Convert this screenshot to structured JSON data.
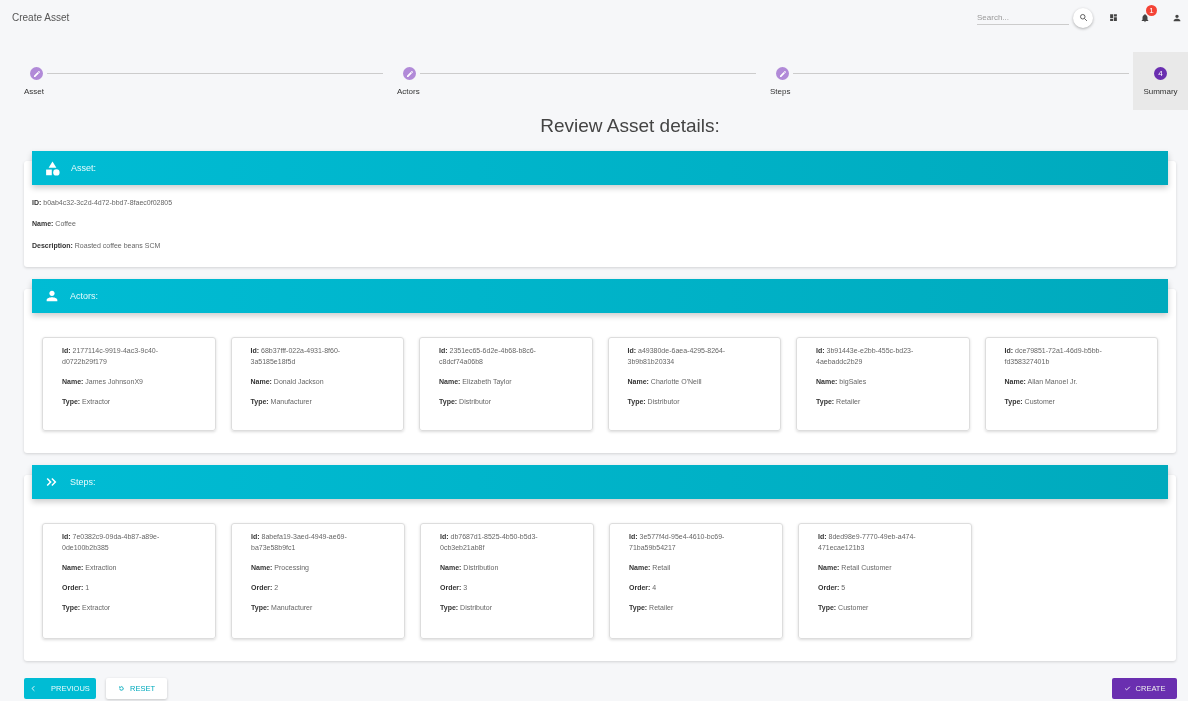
{
  "window": {
    "title": "Create Asset"
  },
  "toolbar": {
    "search": {
      "placeholder": "Search..."
    },
    "notifications": {
      "badge": "1"
    }
  },
  "stepper": [
    {
      "label": "Asset",
      "edited": true,
      "selected": false
    },
    {
      "label": "Actors",
      "edited": true,
      "selected": false
    },
    {
      "label": "Steps",
      "edited": true,
      "selected": false
    },
    {
      "label": "Summary",
      "edited": false,
      "number": "4",
      "selected": true
    }
  ],
  "heading": "Review Asset details:",
  "sections": [
    {
      "kind": "asset",
      "title": "Asset:",
      "fields": [
        "**ID:** b0ab4c32-3c2d-4d72-bbd7-8faec0f02805",
        "**Name:** Coffee",
        "**Description:** Roasted coffee beans SCM"
      ]
    },
    {
      "kind": "actors",
      "title": "Actors:",
      "cards": [
        {
          "fields": [
            "**Id:** 2177114c-9919-4ac3-9c40-d0722b29f179",
            "**Name:** James JohnsonX9",
            "**Type:** Extractor"
          ]
        },
        {
          "fields": [
            "**Id:** 68b37fff-022a-4931-8f60-3a5185e18f5d",
            "**Name:** Donald Jackson",
            "**Type:** Manufacturer"
          ]
        },
        {
          "fields": [
            "**Id:** 2351ec65-6d2e-4b68-b8c6-c8dcf74a06b8",
            "**Name:** Elizabeth Taylor",
            "**Type:** Distributor"
          ]
        },
        {
          "fields": [
            "**Id:** a49380de-6aea-4295-8264-3b9b81b20334",
            "**Name:** Charlotte O'Neill",
            "**Type:** Distributor"
          ]
        },
        {
          "fields": [
            "**Id:** 3b91443e-e2bb-455c-bd23-4aebaddc2b29",
            "**Name:** bigSales",
            "**Type:** Retailer"
          ]
        },
        {
          "fields": [
            "**Id:** dce79851-72a1-46d9-b5bb-fd358327401b",
            "**Name:** Allan Manoel Jr.",
            "**Type:** Customer"
          ]
        }
      ]
    },
    {
      "kind": "steps",
      "title": "Steps:",
      "cards": [
        {
          "fields": [
            "**Id:** 7e0382c9-09da-4b87-a89e-0de100b2b385",
            "**Name:** Extraction",
            "**Order:** 1",
            "**Type:** Extractor"
          ]
        },
        {
          "fields": [
            "**Id:** 8abefa19-3aed-4949-ae69-ba73e58b9fc1",
            "**Name:** Processing",
            "**Order:** 2",
            "**Type:** Manufacturer"
          ]
        },
        {
          "fields": [
            "**Id:** db7687d1-8525-4b50-b5d3-0cb3eb21ab8f",
            "**Name:** Distribution",
            "**Order:** 3",
            "**Type:** Distributor"
          ]
        },
        {
          "fields": [
            "**Id:** 3e577f4d-95e4-4610-bc69-71ba59b54217",
            "**Name:** Retail",
            "**Order:** 4",
            "**Type:** Retailer"
          ]
        },
        {
          "fields": [
            "**Id:** 8ded98e9-7770-49eb-a474-471ecae121b3",
            "**Name:** Retail Customer",
            "**Order:** 5",
            "**Type:** Customer"
          ]
        }
      ]
    }
  ],
  "buttons": [
    {
      "kind": "previous",
      "label": "PREVIOUS"
    },
    {
      "kind": "reset",
      "label": "RESET"
    },
    {
      "kind": "create",
      "label": "CREATE"
    }
  ]
}
